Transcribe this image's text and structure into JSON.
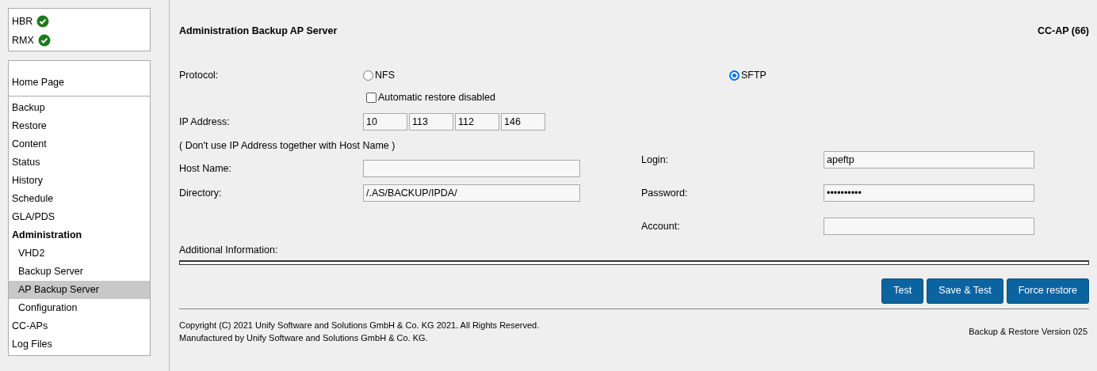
{
  "status": [
    {
      "label": "HBR",
      "ok": true
    },
    {
      "label": "RMX",
      "ok": true
    }
  ],
  "nav": [
    {
      "label": "Home Page",
      "kind": "home",
      "selected": false
    },
    {
      "label": "Backup",
      "kind": "item",
      "selected": false
    },
    {
      "label": "Restore",
      "kind": "item",
      "selected": false
    },
    {
      "label": "Content",
      "kind": "item",
      "selected": false
    },
    {
      "label": "Status",
      "kind": "item",
      "selected": false
    },
    {
      "label": "History",
      "kind": "item",
      "selected": false
    },
    {
      "label": "Schedule",
      "kind": "item",
      "selected": false
    },
    {
      "label": "GLA/PDS",
      "kind": "item",
      "selected": false
    },
    {
      "label": "Administration",
      "kind": "section",
      "selected": false,
      "children": [
        {
          "label": "VHD2",
          "selected": false
        },
        {
          "label": "Backup Server",
          "selected": false
        },
        {
          "label": "AP Backup Server",
          "selected": true
        },
        {
          "label": "Configuration",
          "selected": false
        }
      ]
    },
    {
      "label": "CC-APs",
      "kind": "item",
      "selected": false
    },
    {
      "label": "Log Files",
      "kind": "item",
      "selected": false
    }
  ],
  "page": {
    "title": "Administration Backup AP Server",
    "device": "CC-AP (66)"
  },
  "protocol": {
    "label": "Protocol:",
    "options": [
      {
        "label": "NFS",
        "selected": false
      },
      {
        "label": "SFTP",
        "selected": true
      }
    ]
  },
  "auto_restore": {
    "label": "Automatic restore disabled",
    "checked": false
  },
  "ip": {
    "label": "IP Address:",
    "octets": [
      "10",
      "113",
      "112",
      "146"
    ]
  },
  "note": "( Don't use IP Address together with Host Name )",
  "host": {
    "label": "Host Name:"
  },
  "directory": {
    "label": "Directory:",
    "value": "/.AS/BACKUP/IPDA/"
  },
  "login": {
    "label": "Login:",
    "value": "apeftp"
  },
  "password": {
    "label": "Password:",
    "value": "••••••••••"
  },
  "account": {
    "label": "Account:"
  },
  "additional_info": {
    "label": "Additional Information:"
  },
  "buttons": [
    "Test",
    "Save & Test",
    "Force restore"
  ],
  "footer": {
    "lines": [
      "Copyright (C) 2021 Unify Software and Solutions GmbH & Co. KG 2021. All Rights Reserved.",
      "Manufactured by Unify Software and Solutions GmbH & Co. KG."
    ],
    "version": "Backup & Restore Version 025"
  }
}
